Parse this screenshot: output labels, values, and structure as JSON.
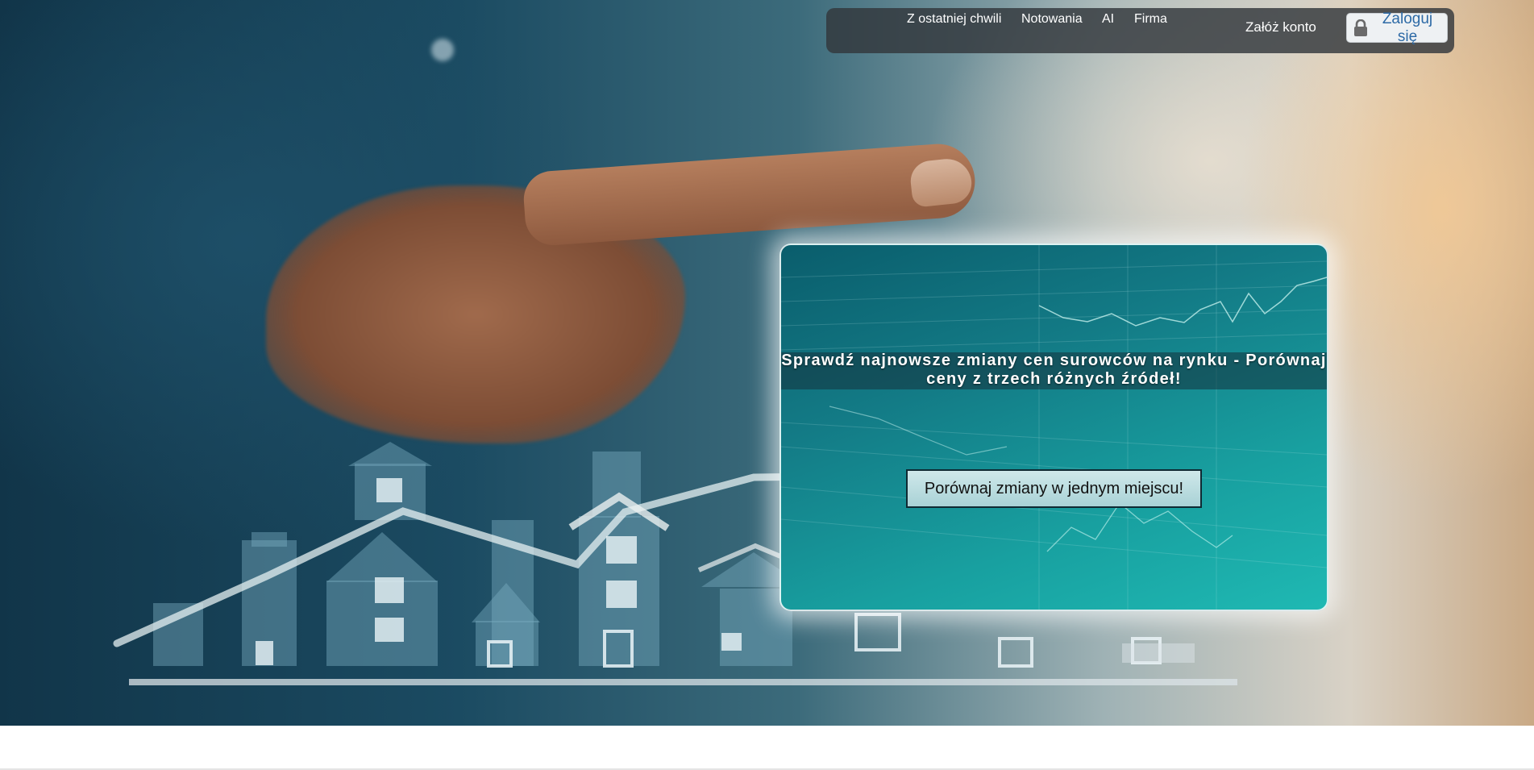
{
  "nav": {
    "links": [
      {
        "label": "Z ostatniej chwili"
      },
      {
        "label": "Notowania"
      },
      {
        "label": "AI"
      },
      {
        "label": "Firma"
      }
    ],
    "register_label": "Załóż konto",
    "login_label": "Zaloguj się",
    "login_icon": "lock-icon"
  },
  "hero": {
    "headline": "Sprawdź najnowsze zmiany cen surowców na rynku - Porównaj ceny z trzech różnych źródeł!",
    "cta_label": "Porównaj zmiany w jednym miejscu!"
  },
  "colors": {
    "navbar_bg": "#32373c",
    "login_text": "#2d6aa6",
    "card_teal": "#18a0a0",
    "cta_bg": "#bfe0e3"
  }
}
